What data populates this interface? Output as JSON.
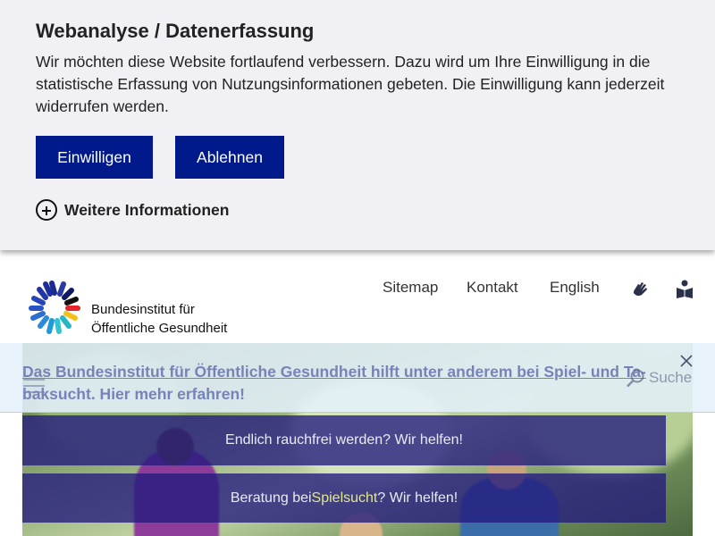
{
  "consent": {
    "title": "Webanalyse / Datenerfassung",
    "text": "Wir möchten diese Website fortlaufend verbessern. Dazu wird um Ihre Einwilligung in die statistische Erfassung von Nutzungsinformationen gebeten. Die Einwilligung kann jederzeit widerrufen werden.",
    "accept_label": "Einwilligen",
    "decline_label": "Ablehnen",
    "more_info_label": "Weitere Informationen",
    "more_info_icon": "plus-circle-icon",
    "button_color": "#001a8c"
  },
  "header": {
    "logo_line1": "Bundesinstitut für",
    "logo_line2": "Öffentliche Gesundheit",
    "nav": {
      "sitemap": "Sitemap",
      "kontakt": "Kontakt",
      "english": "English"
    },
    "icons": [
      "sign-language-icon",
      "easy-language-book-icon"
    ]
  },
  "info_banner": {
    "text_line1": "Das Bundesinstitut für Öffentliche Gesundheit hilft unter anderem bei Spiel- und Ta-",
    "text_line2": "baksucht. Hier mehr erfahren!",
    "close_icon": "close-icon",
    "menu_icon": "menu-icon"
  },
  "search": {
    "label": "Suche",
    "icon": "search-icon"
  },
  "hero": {
    "button1": "Endlich rauchfrei werden? Wir helfen!",
    "button2_pre": "Beratung bei ",
    "button2_hl": "Spielsucht",
    "button2_post": "? Wir helfen!"
  }
}
